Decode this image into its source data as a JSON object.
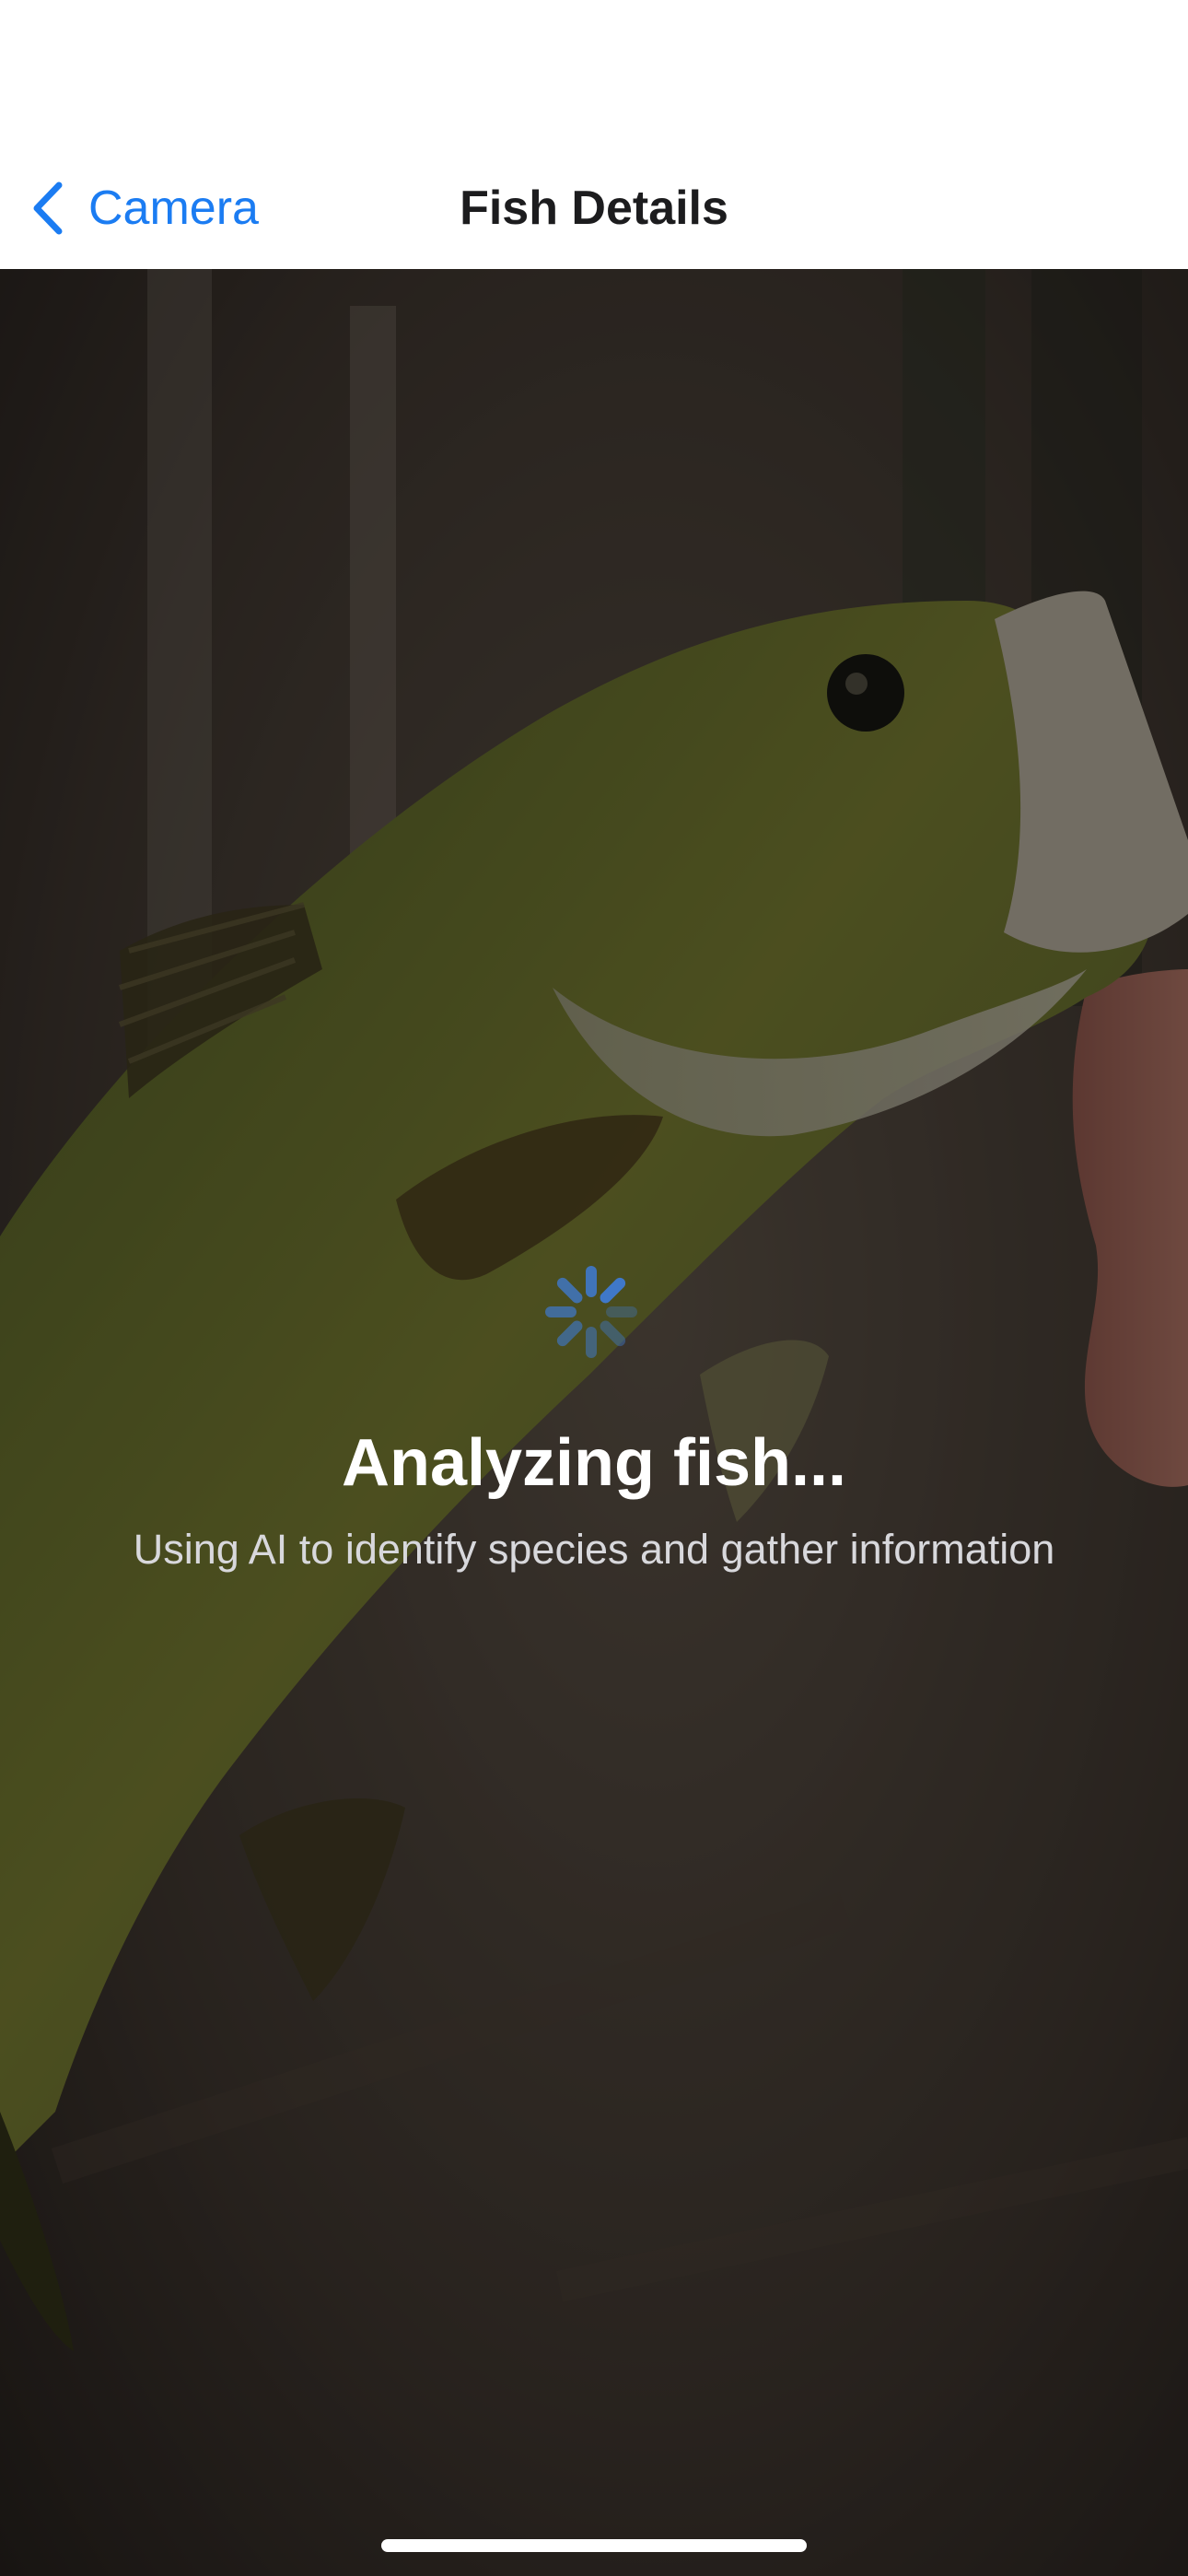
{
  "nav": {
    "back_label": "Camera",
    "title": "Fish Details",
    "accent_color": "#1b7cf2"
  },
  "photo": {
    "subject": "fish-photo"
  },
  "loading": {
    "title": "Analyzing fish...",
    "subtitle": "Using AI to identify species and gather information",
    "spinner_icon": "activity-spinner-icon",
    "spinner_color": "#3f78c9"
  }
}
